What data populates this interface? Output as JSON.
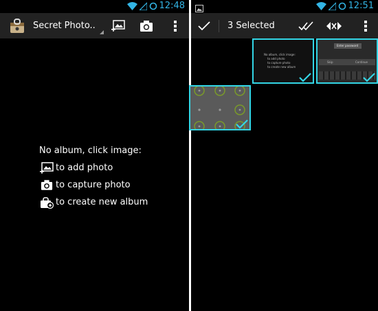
{
  "left": {
    "status": {
      "time": "12:48"
    },
    "actionbar": {
      "title": "Secret Photo.."
    },
    "empty": {
      "heading": "No album, click image:",
      "add_photo": "to add photo",
      "capture_photo": "to capture photo",
      "create_album": "to create new album"
    }
  },
  "right": {
    "status": {
      "time": "12:51"
    },
    "actionbar": {
      "selected": "3 Selected"
    },
    "thumb_album": {
      "line1": "No album, click image:",
      "line2": "to add photo",
      "line3": "to capture photo",
      "line4": "to create new album"
    },
    "thumb_dialog": {
      "title": "Enter password",
      "btn_left": "Skip",
      "btn_right": "Continue"
    }
  },
  "colors": {
    "accent": "#33b5e5",
    "selection": "#33d6e6",
    "actionbar": "#222222"
  }
}
